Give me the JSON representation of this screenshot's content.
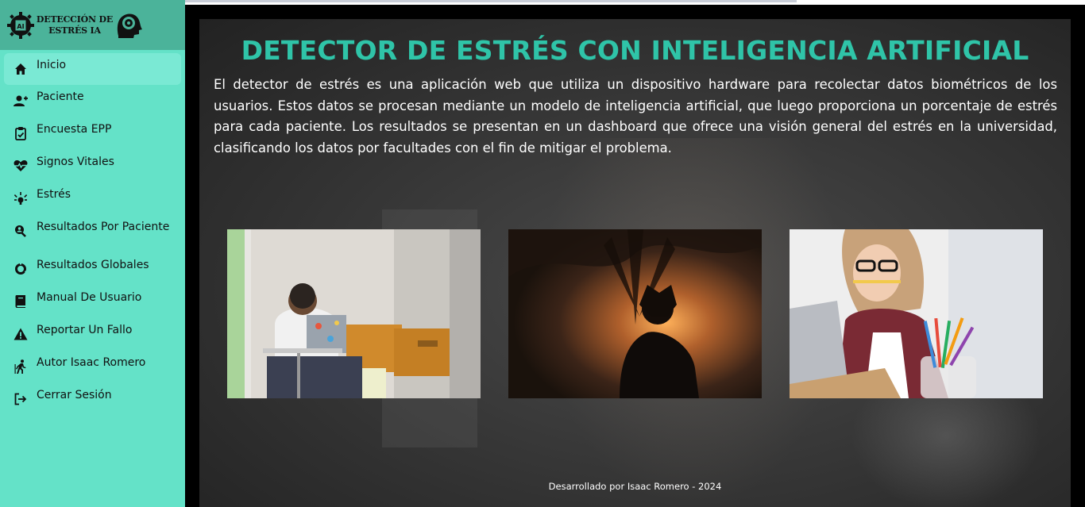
{
  "brand": {
    "title": "DETECCIÓN DE ESTRÉS IA"
  },
  "sidebar": {
    "items": [
      {
        "label": "Inicio",
        "icon": "home-icon"
      },
      {
        "label": "Paciente",
        "icon": "add-user-icon"
      },
      {
        "label": "Encuesta EPP",
        "icon": "clipboard-check-icon"
      },
      {
        "label": "Signos Vitales",
        "icon": "heart-pulse-icon"
      },
      {
        "label": "Estrés",
        "icon": "stress-icon"
      },
      {
        "label": "Resultados Por Paciente",
        "icon": "search-user-icon"
      },
      {
        "label": "Resultados Globales",
        "icon": "donut-chart-icon"
      },
      {
        "label": "Manual De Usuario",
        "icon": "book-icon"
      },
      {
        "label": "Reportar Un Fallo",
        "icon": "warning-icon"
      },
      {
        "label": "Autor Isaac Romero",
        "icon": "person-walking-icon"
      },
      {
        "label": "Cerrar Sesión",
        "icon": "logout-icon"
      }
    ]
  },
  "main": {
    "heading": "DETECTOR DE ESTRÉS CON INTELIGENCIA ARTIFICIAL",
    "description": "El detector de estrés es una aplicación web que utiliza un dispositivo hardware para recolectar datos biométricos de los usuarios. Estos datos se procesan mediante un modelo de inteligencia artificial, que luego proporciona un porcentaje de estrés para cada paciente. Los resultados se presentan en un dashboard que ofrece una visión general del estrés en la universidad, clasificando los datos por facultades con el fin de mitigar el problema.",
    "footer": "Desarrollado por Isaac Romero - 2024"
  },
  "colors": {
    "sidebar": "#64e2c8",
    "brand_bar": "#4bb39a",
    "heading": "#2fc4a8",
    "active_item": "#7ae9d4"
  }
}
